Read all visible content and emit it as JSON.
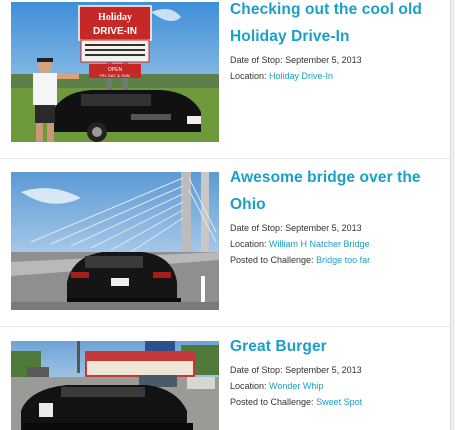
{
  "posts": [
    {
      "title": "Checking out the cool old Holiday Drive-In",
      "photo_alt": "Man standing beside black Camaro in front of Holiday Drive-In sign",
      "sign_top": "Holiday",
      "sign_main": "DRIVE-IN",
      "sign_open": "OPEN",
      "sign_days": "FRI. SAT. & SUN.",
      "date_label": "Date of Stop:",
      "date": "September 5, 2013",
      "location_label": "Location:",
      "location": "Holiday Drive-In"
    },
    {
      "title": "Awesome bridge over the Ohio",
      "photo_alt": "Black Camaro on cable-stayed bridge",
      "date_label": "Date of Stop:",
      "date": "September 5, 2013",
      "location_label": "Location:",
      "location": "William H Natcher Bridge",
      "challenge_label": "Posted to Challenge:",
      "challenge": "Bridge too far"
    },
    {
      "title": "Great Burger",
      "photo_alt": "Black Camaro parked at Wonder Whip burger stand",
      "date_label": "Date of Stop:",
      "date": "September 5, 2013",
      "location_label": "Location:",
      "location": "Wonder Whip",
      "challenge_label": "Posted to Challenge:",
      "challenge": "Sweet Spot"
    }
  ]
}
